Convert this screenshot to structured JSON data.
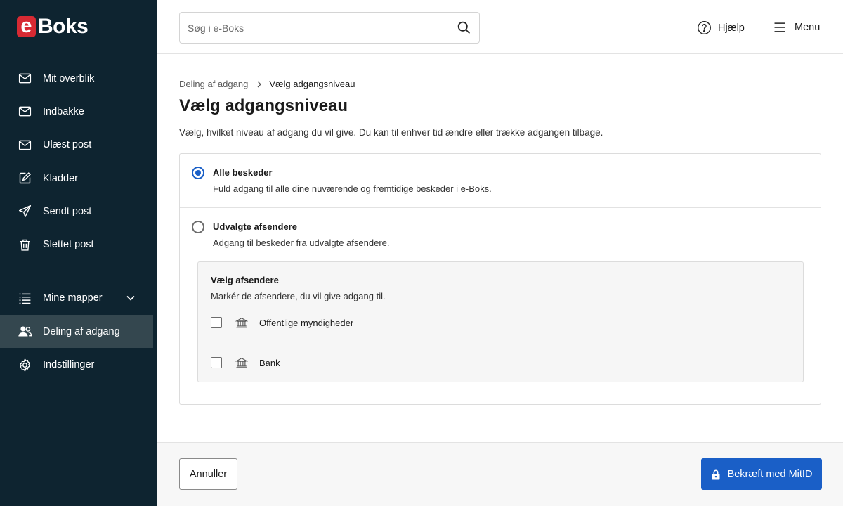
{
  "brand": {
    "logo_letter": "e",
    "logo_text": "Boks",
    "accent_color": "#d72a33"
  },
  "sidebar": {
    "background": "#0e2430",
    "items": [
      {
        "label": "Mit overblik",
        "icon": "envelope-icon"
      },
      {
        "label": "Indbakke",
        "icon": "envelope-icon"
      },
      {
        "label": "Ulæst post",
        "icon": "envelope-icon"
      },
      {
        "label": "Kladder",
        "icon": "edit-icon"
      },
      {
        "label": "Sendt post",
        "icon": "send-icon"
      },
      {
        "label": "Slettet post",
        "icon": "trash-icon"
      }
    ],
    "secondary_items": [
      {
        "label": "Mine mapper",
        "icon": "list-icon",
        "expandable": true
      },
      {
        "label": "Deling af adgang",
        "icon": "users-icon",
        "active": true
      },
      {
        "label": "Indstillinger",
        "icon": "gear-icon"
      }
    ]
  },
  "topbar": {
    "search_placeholder": "Søg i e-Boks",
    "help_label": "Hjælp",
    "menu_label": "Menu"
  },
  "breadcrumb": {
    "parent": "Deling af adgang",
    "current": "Vælg adgangsniveau"
  },
  "page": {
    "title": "Vælg adgangsniveau",
    "description": "Vælg, hvilket niveau af adgang du vil give. Du kan til enhver tid ændre eller trække adgangen tilbage."
  },
  "options": [
    {
      "title": "Alle beskeder",
      "description": "Fuld adgang til alle dine nuværende og fremtidige beskeder i e-Boks.",
      "selected": true
    },
    {
      "title": "Udvalgte afsendere",
      "description": "Adgang til beskeder fra udvalgte afsendere.",
      "selected": false
    }
  ],
  "sender_panel": {
    "title": "Vælg afsendere",
    "description": "Markér de afsendere, du vil give adgang til.",
    "senders": [
      {
        "label": "Offentlige myndigheder",
        "icon": "bank-icon",
        "checked": false
      },
      {
        "label": "Bank",
        "icon": "bank-icon",
        "checked": false
      }
    ]
  },
  "footer": {
    "cancel_label": "Annuller",
    "confirm_label": "Bekræft med MitID",
    "confirm_color": "#1a5fc7"
  }
}
